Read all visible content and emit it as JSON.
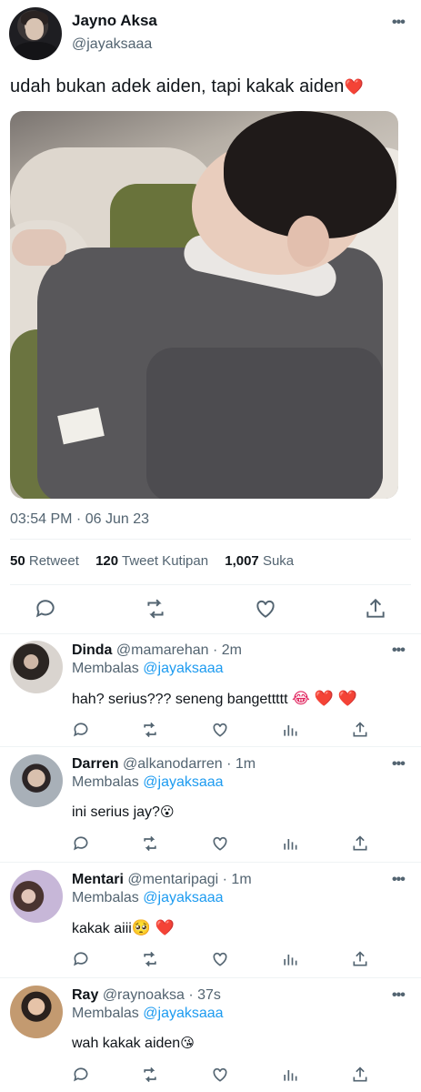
{
  "tweet": {
    "author_name": "Jayno Aksa",
    "author_handle": "@jayaksaaa",
    "text": "udah bukan adek aiden, tapi kakak aiden",
    "text_emoji": "❤️",
    "timestamp": "03:54 PM · 06 Jun 23",
    "retweets": "50",
    "retweets_label": "Retweet",
    "quotes": "120",
    "quotes_label": "Tweet Kutipan",
    "likes": "1,007",
    "likes_label": "Suka",
    "photo_alt": "sleeping toddler in grey sweater hugging green plush"
  },
  "actions_icons": [
    "reply-icon",
    "retweet-icon",
    "like-icon",
    "share-icon"
  ],
  "reply_prefix": "Membalas",
  "replies": [
    {
      "name": "Dinda",
      "handle": "@mamarehan",
      "time": "· 2m",
      "replying_to": "@jayaksaaa",
      "text": "hah? serius??? seneng bangettttt",
      "emoji": "😂 ❤️ ❤️"
    },
    {
      "name": "Darren",
      "handle": "@alkanodarren",
      "time": "· 1m",
      "replying_to": "@jayaksaaa",
      "text": "ini serius jay?",
      "emoji": "😮"
    },
    {
      "name": "Mentari",
      "handle": "@mentaripagi",
      "time": "· 1m",
      "replying_to": "@jayaksaaa",
      "text": "kakak aiii",
      "emoji": "🥺 ❤️"
    },
    {
      "name": "Ray",
      "handle": "@raynoaksa",
      "time": "· 37s",
      "replying_to": "@jayaksaaa",
      "text": "wah kakak aiden",
      "emoji": "😘"
    }
  ],
  "colors": {
    "accent": "#1d9bf0",
    "muted": "#536471",
    "heart": "#e0245e"
  }
}
